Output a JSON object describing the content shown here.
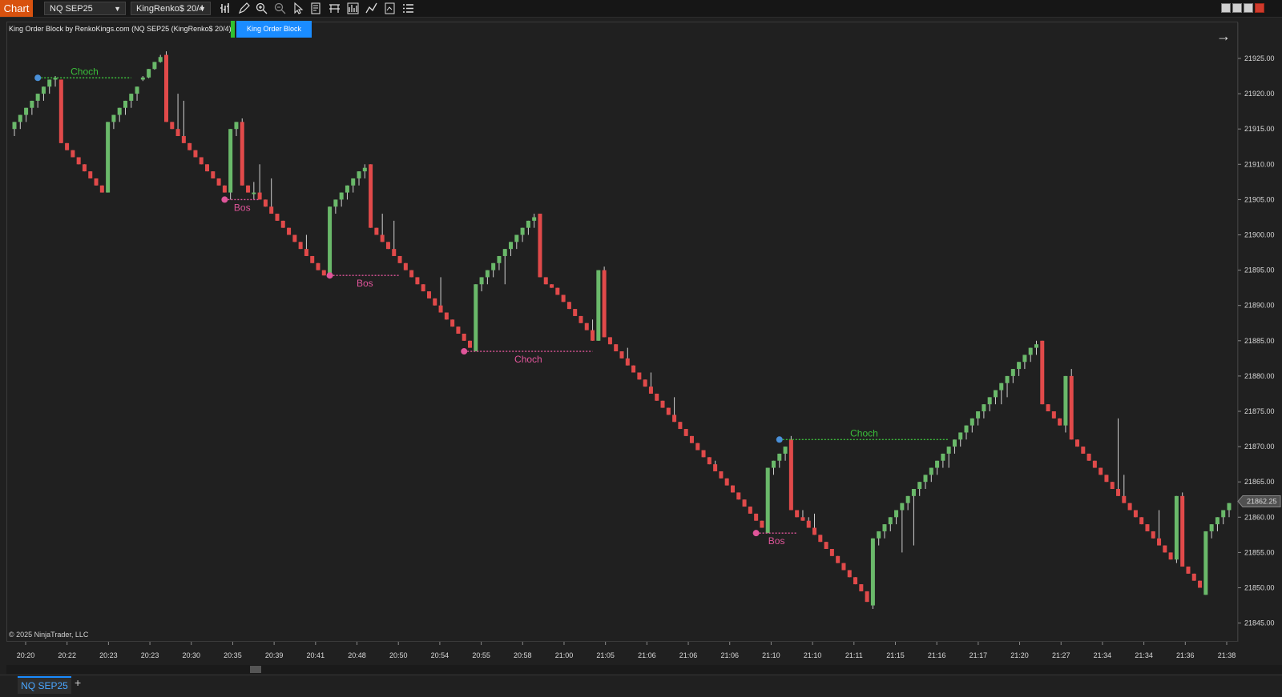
{
  "toolbar": {
    "chart_label": "Chart",
    "instrument": "NQ SEP25",
    "bar_type": "KingRenko$ 20/4",
    "icons": [
      "bars-icon",
      "pencil-icon",
      "zoom-in-icon",
      "zoom-out-icon",
      "pointer-icon",
      "data-box-icon",
      "hlines-icon",
      "drawing-tools-icon",
      "indicator-icon",
      "strategy-icon",
      "properties-icon"
    ]
  },
  "indicator": {
    "label": "King Order Block by RenkoKings.com (NQ SEP25 (KingRenko$ 20/4))",
    "button": "King Order Block"
  },
  "colors": {
    "up": "#6ab96a",
    "down": "#e14a4a",
    "choch_up": "#3bbf3b",
    "choch_down": "#e0559a",
    "bos": "#e0559a",
    "pivot_blue": "#4a90d9",
    "price_marker": "#505050"
  },
  "copyright": "© 2025 NinjaTrader, LLC",
  "price_marker": "21862.25",
  "tab": "NQ SEP25",
  "chart_data": {
    "type": "candlestick",
    "y_axis": {
      "ticks": [
        "21925.00",
        "21920.00",
        "21915.00",
        "21910.00",
        "21905.00",
        "21900.00",
        "21895.00",
        "21890.00",
        "21885.00",
        "21880.00",
        "21875.00",
        "21870.00",
        "21865.00",
        "21860.00",
        "21855.00",
        "21850.00",
        "21845.00"
      ],
      "range": [
        21843.5,
        21926.5
      ]
    },
    "x_axis": {
      "ticks": [
        "20:20",
        "20:22",
        "20:23",
        "20:23",
        "20:30",
        "20:35",
        "20:39",
        "20:41",
        "20:48",
        "20:50",
        "20:54",
        "20:55",
        "20:58",
        "21:00",
        "21:05",
        "21:06",
        "21:06",
        "21:06",
        "21:10",
        "21:10",
        "21:11",
        "21:15",
        "21:16",
        "21:17",
        "21:20",
        "21:27",
        "21:34",
        "21:34",
        "21:36",
        "21:38"
      ]
    },
    "annotations": [
      {
        "label": "Choch",
        "kind": "bullish",
        "price": 21922.25,
        "from_bar": 4,
        "to_bar": 20
      },
      {
        "label": "Bos",
        "kind": "bearish",
        "price": 21905.0,
        "from_bar": 36,
        "to_bar": 42
      },
      {
        "label": "Bos",
        "kind": "bearish",
        "price": 21894.25,
        "from_bar": 54,
        "to_bar": 66
      },
      {
        "label": "Choch",
        "kind": "bearish",
        "price": 21883.5,
        "from_bar": 77,
        "to_bar": 99
      },
      {
        "label": "Choch",
        "kind": "bullish",
        "price": 21871.0,
        "from_bar": 131,
        "to_bar": 160
      },
      {
        "label": "Bos",
        "kind": "bearish",
        "price": 21857.75,
        "from_bar": 127,
        "to_bar": 134
      }
    ],
    "candles": [
      [
        21915,
        21916,
        21914,
        21916
      ],
      [
        21916,
        21917,
        21915,
        21917
      ],
      [
        21917,
        21918,
        21916,
        21918
      ],
      [
        21918,
        21919,
        21917,
        21919
      ],
      [
        21919,
        21920,
        21918,
        21920
      ],
      [
        21920,
        21921,
        21919,
        21921
      ],
      [
        21921,
        21922,
        21920,
        21922
      ],
      [
        21922,
        21922.5,
        21921,
        21922.25
      ],
      [
        21922,
        21922,
        21913,
        21913
      ],
      [
        21913,
        21913,
        21912,
        21912
      ],
      [
        21912,
        21912,
        21911,
        21911
      ],
      [
        21911,
        21911,
        21910,
        21910
      ],
      [
        21910,
        21910,
        21909,
        21909
      ],
      [
        21909,
        21909,
        21908,
        21908
      ],
      [
        21908,
        21908,
        21907,
        21907
      ],
      [
        21907,
        21907,
        21906,
        21906
      ],
      [
        21906,
        21916,
        21906,
        21916
      ],
      [
        21916,
        21917,
        21915,
        21917
      ],
      [
        21917,
        21918,
        21916,
        21918
      ],
      [
        21918,
        21919,
        21917,
        21919
      ],
      [
        21919,
        21920,
        21918,
        21920
      ],
      [
        21920,
        21921,
        21919,
        21921
      ],
      [
        21922,
        21922.5,
        21921.8,
        21922.3
      ],
      [
        21922.3,
        21923.5,
        21922.2,
        21923.5
      ],
      [
        21923.5,
        21924.5,
        21923.4,
        21924.5
      ],
      [
        21924.5,
        21925.5,
        21924.4,
        21925.2
      ],
      [
        21925.5,
        21926,
        21916,
        21916
      ],
      [
        21916,
        21916,
        21915,
        21915
      ],
      [
        21915,
        21920,
        21914,
        21914
      ],
      [
        21914,
        21919,
        21913,
        21913
      ],
      [
        21913,
        21913,
        21912,
        21912
      ],
      [
        21912,
        21912,
        21911,
        21911
      ],
      [
        21911,
        21911,
        21910,
        21910
      ],
      [
        21910,
        21910,
        21909,
        21909
      ],
      [
        21909,
        21909,
        21908,
        21908
      ],
      [
        21908,
        21908,
        21907,
        21907
      ],
      [
        21907,
        21907,
        21906,
        21906
      ],
      [
        21906,
        21915,
        21905,
        21915
      ],
      [
        21915,
        21916,
        21914,
        21916
      ],
      [
        21916,
        21916.5,
        21907,
        21907
      ],
      [
        21907,
        21907,
        21906,
        21906
      ],
      [
        21906,
        21907.5,
        21905,
        21906
      ],
      [
        21906,
        21910,
        21905,
        21905
      ],
      [
        21905,
        21905,
        21904,
        21904
      ],
      [
        21904,
        21908,
        21903,
        21903
      ],
      [
        21903,
        21903,
        21902,
        21902
      ],
      [
        21902,
        21902,
        21901,
        21901
      ],
      [
        21901,
        21901,
        21900,
        21900
      ],
      [
        21900,
        21900,
        21899,
        21899
      ],
      [
        21899,
        21899,
        21898,
        21898
      ],
      [
        21898,
        21900,
        21897,
        21897
      ],
      [
        21897,
        21897,
        21896,
        21896
      ],
      [
        21896,
        21896,
        21895,
        21895
      ],
      [
        21895,
        21895,
        21894.25,
        21894.25
      ],
      [
        21894.25,
        21904,
        21894.25,
        21904
      ],
      [
        21904,
        21905,
        21903,
        21905
      ],
      [
        21905,
        21906,
        21904,
        21906
      ],
      [
        21906,
        21907,
        21905,
        21907
      ],
      [
        21907,
        21908,
        21906,
        21908
      ],
      [
        21908,
        21909,
        21907,
        21909
      ],
      [
        21909,
        21910,
        21908,
        21909.5
      ],
      [
        21910,
        21910,
        21901,
        21901
      ],
      [
        21901,
        21901,
        21900,
        21900
      ],
      [
        21900,
        21903,
        21899,
        21899
      ],
      [
        21899,
        21899,
        21898,
        21898
      ],
      [
        21898,
        21902,
        21897,
        21897
      ],
      [
        21897,
        21897,
        21896,
        21896
      ],
      [
        21896,
        21896,
        21895,
        21895
      ],
      [
        21895,
        21895,
        21894,
        21894
      ],
      [
        21894,
        21894,
        21893,
        21893
      ],
      [
        21893,
        21893,
        21892,
        21892
      ],
      [
        21892,
        21892,
        21891,
        21891
      ],
      [
        21891,
        21891,
        21890,
        21890
      ],
      [
        21890,
        21894,
        21889,
        21889
      ],
      [
        21889,
        21889,
        21888,
        21888
      ],
      [
        21888,
        21888,
        21887,
        21887
      ],
      [
        21887,
        21887,
        21886,
        21886
      ],
      [
        21886,
        21886,
        21885,
        21885
      ],
      [
        21885,
        21885,
        21884,
        21884
      ],
      [
        21883.5,
        21893,
        21883.5,
        21893
      ],
      [
        21893,
        21894,
        21892,
        21894
      ],
      [
        21894,
        21895,
        21893,
        21895
      ],
      [
        21895,
        21896,
        21894,
        21896
      ],
      [
        21896,
        21897,
        21895,
        21897
      ],
      [
        21897,
        21898,
        21893,
        21898
      ],
      [
        21898,
        21899,
        21897,
        21899
      ],
      [
        21899,
        21900,
        21898,
        21900
      ],
      [
        21900,
        21901,
        21899,
        21901
      ],
      [
        21901,
        21902,
        21900,
        21902
      ],
      [
        21902,
        21903,
        21901,
        21902.5
      ],
      [
        21903,
        21903,
        21894,
        21894
      ],
      [
        21894,
        21894,
        21893,
        21893
      ],
      [
        21893,
        21893,
        21892.5,
        21892.5
      ],
      [
        21892.5,
        21892.5,
        21891.5,
        21891.5
      ],
      [
        21891.5,
        21891.5,
        21890.5,
        21890.5
      ],
      [
        21890.5,
        21890.5,
        21889.5,
        21889.5
      ],
      [
        21889.5,
        21889.5,
        21888.5,
        21888.5
      ],
      [
        21888.5,
        21888.5,
        21887.5,
        21887.5
      ],
      [
        21887.5,
        21887.5,
        21886.5,
        21886.5
      ],
      [
        21886.5,
        21888,
        21885,
        21885
      ],
      [
        21885,
        21895,
        21885,
        21895
      ],
      [
        21895,
        21895.5,
        21885.5,
        21885.5
      ],
      [
        21885.5,
        21885.5,
        21884.5,
        21884.5
      ],
      [
        21884.5,
        21884.5,
        21883.5,
        21883.5
      ],
      [
        21883.5,
        21883.5,
        21882.5,
        21882.5
      ],
      [
        21882.5,
        21884,
        21881.5,
        21881.5
      ],
      [
        21881.5,
        21881.5,
        21880.5,
        21880.5
      ],
      [
        21880.5,
        21880.5,
        21879.5,
        21879.5
      ],
      [
        21879.5,
        21879.5,
        21878.5,
        21878.5
      ],
      [
        21878.5,
        21880.5,
        21877.5,
        21877.5
      ],
      [
        21877.5,
        21877.5,
        21876.5,
        21876.5
      ],
      [
        21876.5,
        21876.5,
        21875.5,
        21875.5
      ],
      [
        21875.5,
        21875.5,
        21874.5,
        21874.5
      ],
      [
        21874.5,
        21877,
        21873.5,
        21873.5
      ],
      [
        21873.5,
        21873.5,
        21872.5,
        21872.5
      ],
      [
        21872.5,
        21872.5,
        21871.5,
        21871.5
      ],
      [
        21871.5,
        21871.5,
        21870.5,
        21870.5
      ],
      [
        21870.5,
        21870.5,
        21869.5,
        21869.5
      ],
      [
        21869.5,
        21869.5,
        21868.5,
        21868.5
      ],
      [
        21868.5,
        21868.5,
        21867.5,
        21867.5
      ],
      [
        21867.5,
        21868,
        21866.5,
        21866.5
      ],
      [
        21866.5,
        21866.5,
        21865.5,
        21865.5
      ],
      [
        21865.5,
        21865.5,
        21864.5,
        21864.5
      ],
      [
        21864.5,
        21864.5,
        21863.5,
        21863.5
      ],
      [
        21863.5,
        21863.5,
        21862.5,
        21862.5
      ],
      [
        21862.5,
        21862.5,
        21861.5,
        21861.5
      ],
      [
        21861.5,
        21861.5,
        21860.5,
        21860.5
      ],
      [
        21860.5,
        21860.5,
        21859.5,
        21859.5
      ],
      [
        21859.5,
        21859.5,
        21858.5,
        21858.5
      ],
      [
        21857.75,
        21867,
        21857.75,
        21867
      ],
      [
        21867,
        21868,
        21866,
        21868
      ],
      [
        21868,
        21869,
        21867,
        21869
      ],
      [
        21869,
        21870,
        21868,
        21870
      ],
      [
        21871,
        21871.5,
        21861,
        21861
      ],
      [
        21861,
        21861,
        21860,
        21860
      ],
      [
        21860,
        21861,
        21859.5,
        21859.5
      ],
      [
        21859.5,
        21860,
        21858.5,
        21858.5
      ],
      [
        21858.5,
        21860.5,
        21857.5,
        21857.5
      ],
      [
        21857.5,
        21857.5,
        21856.5,
        21856.5
      ],
      [
        21856.5,
        21856.5,
        21855.5,
        21855.5
      ],
      [
        21855.5,
        21855.5,
        21854.5,
        21854.5
      ],
      [
        21854.5,
        21854.5,
        21853.5,
        21853.5
      ],
      [
        21853.5,
        21853.5,
        21852.5,
        21852.5
      ],
      [
        21852.5,
        21852.5,
        21851.5,
        21851.5
      ],
      [
        21851.5,
        21851.5,
        21850.5,
        21850.5
      ],
      [
        21850.5,
        21850.5,
        21849.5,
        21849.5
      ],
      [
        21849.5,
        21849.5,
        21848,
        21848
      ],
      [
        21847.5,
        21857,
        21847,
        21857
      ],
      [
        21857,
        21858,
        21856,
        21858
      ],
      [
        21858,
        21859,
        21857,
        21859
      ],
      [
        21859,
        21860,
        21858,
        21860
      ],
      [
        21860,
        21861,
        21859,
        21861
      ],
      [
        21861,
        21862,
        21855,
        21862
      ],
      [
        21862,
        21863,
        21861,
        21863
      ],
      [
        21863,
        21864,
        21856,
        21864
      ],
      [
        21864,
        21865,
        21863,
        21865
      ],
      [
        21865,
        21866,
        21864,
        21866
      ],
      [
        21866,
        21867,
        21865,
        21867
      ],
      [
        21867,
        21868,
        21866,
        21868
      ],
      [
        21868,
        21869,
        21867,
        21869
      ],
      [
        21869,
        21870,
        21867,
        21870
      ],
      [
        21870,
        21871,
        21869,
        21871
      ],
      [
        21871,
        21872,
        21870,
        21872
      ],
      [
        21872,
        21873,
        21871,
        21873
      ],
      [
        21873,
        21874,
        21872,
        21874
      ],
      [
        21874,
        21875,
        21873,
        21875
      ],
      [
        21875,
        21876,
        21874,
        21876
      ],
      [
        21876,
        21877,
        21875,
        21877
      ],
      [
        21877,
        21878,
        21876,
        21878
      ],
      [
        21878,
        21879,
        21876,
        21879
      ],
      [
        21879,
        21880,
        21877,
        21880
      ],
      [
        21880,
        21881,
        21879,
        21881
      ],
      [
        21881,
        21882,
        21880,
        21882
      ],
      [
        21882,
        21883,
        21881,
        21883
      ],
      [
        21883,
        21884,
        21882,
        21884
      ],
      [
        21884,
        21885,
        21883,
        21884.5
      ],
      [
        21885,
        21885,
        21876,
        21876
      ],
      [
        21876,
        21876,
        21875,
        21875
      ],
      [
        21875,
        21875,
        21874,
        21874
      ],
      [
        21874,
        21874,
        21873,
        21873
      ],
      [
        21873,
        21880,
        21872,
        21880
      ],
      [
        21880,
        21881,
        21871,
        21871
      ],
      [
        21871,
        21871,
        21870,
        21870
      ],
      [
        21870,
        21870,
        21869,
        21869
      ],
      [
        21869,
        21869,
        21868,
        21868
      ],
      [
        21868,
        21868,
        21867,
        21867
      ],
      [
        21867,
        21867,
        21866,
        21866
      ],
      [
        21866,
        21866,
        21865,
        21865
      ],
      [
        21865,
        21865,
        21864,
        21864
      ],
      [
        21864,
        21874,
        21863,
        21863
      ],
      [
        21863,
        21866,
        21862,
        21862
      ],
      [
        21862,
        21862,
        21861,
        21861
      ],
      [
        21861,
        21861,
        21860,
        21860
      ],
      [
        21860,
        21860,
        21859,
        21859
      ],
      [
        21859,
        21859,
        21858,
        21858
      ],
      [
        21858,
        21858,
        21857,
        21857
      ],
      [
        21857,
        21861,
        21856,
        21856
      ],
      [
        21856,
        21856,
        21855,
        21855
      ],
      [
        21855,
        21855,
        21854,
        21854
      ],
      [
        21854,
        21863,
        21853.5,
        21863
      ],
      [
        21863,
        21863.5,
        21853,
        21853
      ],
      [
        21853,
        21853,
        21852,
        21852
      ],
      [
        21852,
        21852,
        21851,
        21851
      ],
      [
        21851,
        21851,
        21850,
        21850
      ],
      [
        21849,
        21858,
        21849,
        21858
      ],
      [
        21858,
        21859,
        21857,
        21859
      ],
      [
        21859,
        21860,
        21858,
        21860
      ],
      [
        21860,
        21861,
        21859,
        21861
      ],
      [
        21861,
        21862,
        21860,
        21862
      ]
    ]
  }
}
